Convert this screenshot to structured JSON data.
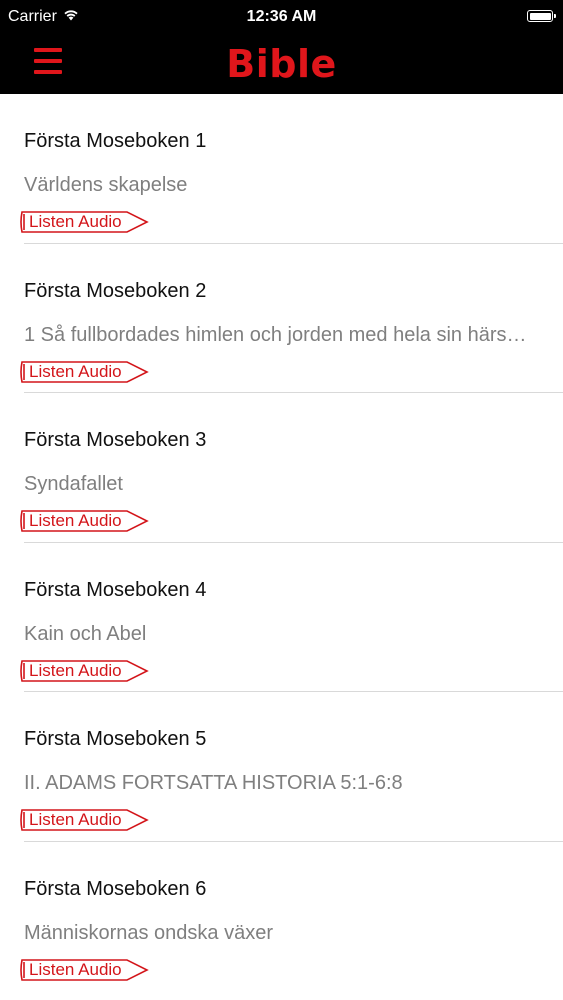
{
  "status_bar": {
    "carrier": "Carrier",
    "time": "12:36 AM",
    "wifi_icon": "wifi-icon",
    "battery_icon": "battery-icon"
  },
  "nav": {
    "title": "Bible",
    "menu_icon": "hamburger-menu-icon",
    "accent_color": "#e0161b"
  },
  "chapters": [
    {
      "title": "Första Moseboken 1",
      "subtitle": "Världens skapelse",
      "button_label": "Listen Audio"
    },
    {
      "title": "Första Moseboken 2",
      "subtitle": "1 Så fullbordades himlen och jorden med hela sin härs…",
      "button_label": "Listen Audio"
    },
    {
      "title": "Första Moseboken 3",
      "subtitle": "Syndafallet",
      "button_label": "Listen Audio"
    },
    {
      "title": "Första Moseboken 4",
      "subtitle": "Kain och Abel",
      "button_label": "Listen Audio"
    },
    {
      "title": "Första Moseboken 5",
      "subtitle": "II. ADAMS FORTSATTA HISTORIA 5:1-6:8",
      "button_label": "Listen Audio"
    },
    {
      "title": "Första Moseboken 6",
      "subtitle": "Människornas ondska växer",
      "button_label": "Listen Audio"
    }
  ]
}
